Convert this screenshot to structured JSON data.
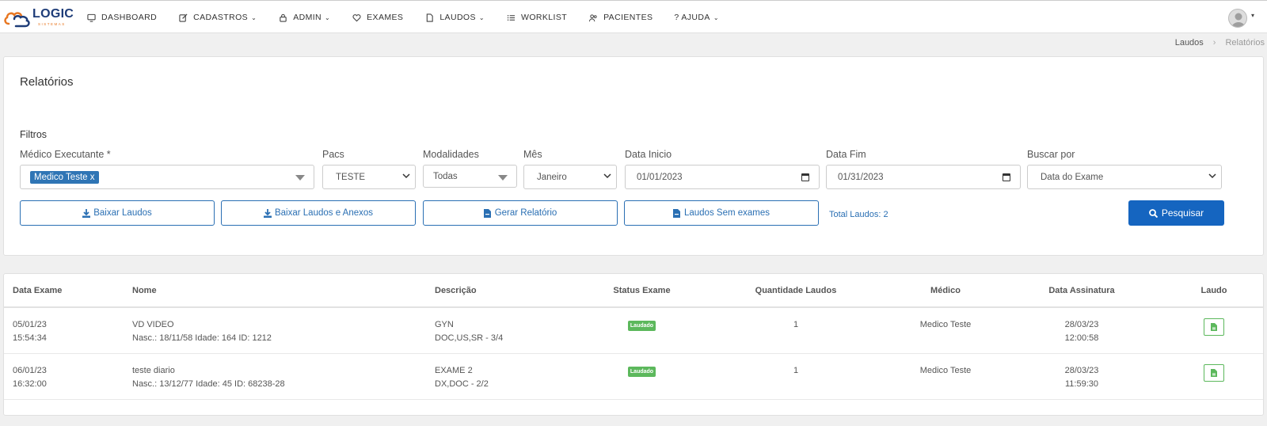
{
  "brand": {
    "name": "LOGIC",
    "sub": "SISTEMAS"
  },
  "nav": [
    {
      "label": "DASHBOARD",
      "icon": "monitor-icon",
      "caret": false
    },
    {
      "label": "CADASTROS",
      "icon": "edit-icon",
      "caret": true
    },
    {
      "label": "ADMIN",
      "icon": "lock-icon",
      "caret": true
    },
    {
      "label": "EXAMES",
      "icon": "heart-icon",
      "caret": false
    },
    {
      "label": "LAUDOS",
      "icon": "file-icon",
      "caret": true
    },
    {
      "label": "WORKLIST",
      "icon": "list-icon",
      "caret": false
    },
    {
      "label": "PACIENTES",
      "icon": "users-icon",
      "caret": false
    },
    {
      "label": "? AJUDA",
      "icon": "",
      "caret": true
    }
  ],
  "breadcrumb": {
    "parent": "Laudos",
    "current": "Relatórios"
  },
  "page_title": "Relatórios",
  "filters": {
    "title": "Filtros",
    "medico": {
      "label": "Médico Executante *",
      "tag": "Medico Teste",
      "tag_remove": "x"
    },
    "pacs": {
      "label": "Pacs",
      "value": "TESTE"
    },
    "modalidades": {
      "label": "Modalidades",
      "value": "Todas"
    },
    "mes": {
      "label": "Mês",
      "value": "Janeiro"
    },
    "data_inicio": {
      "label": "Data Inicio",
      "value": "01/01/2023"
    },
    "data_fim": {
      "label": "Data Fim",
      "value": "01/31/2023"
    },
    "buscar_por": {
      "label": "Buscar por",
      "value": "Data do Exame"
    }
  },
  "actions": {
    "baixar_laudos": "Baixar Laudos",
    "baixar_anexos": "Baixar Laudos e Anexos",
    "gerar_relatorio": "Gerar Relatório",
    "sem_exames": "Laudos Sem exames",
    "total": "Total Laudos: 2",
    "pesquisar": "Pesquisar"
  },
  "table": {
    "headers": [
      "Data Exame",
      "Nome",
      "Descrição",
      "Status Exame",
      "Quantidade Laudos",
      "Médico",
      "Data Assinatura",
      "Laudo"
    ],
    "rows": [
      {
        "date": "05/01/23",
        "time": "15:54:34",
        "name": "VD VIDEO",
        "info": "Nasc.: 18/11/58 Idade: 164 ID: 1212",
        "desc1": "GYN",
        "desc2": "DOC,US,SR - 3/4",
        "status": "Laudado",
        "qty": "1",
        "medico": "Medico Teste",
        "sign_date": "28/03/23",
        "sign_time": "12:00:58"
      },
      {
        "date": "06/01/23",
        "time": "16:32:00",
        "name": "teste diario",
        "info": "Nasc.: 13/12/77 Idade: 45 ID: 68238-28",
        "desc1": "EXAME 2",
        "desc2": "DX,DOC - 2/2",
        "status": "Laudado",
        "qty": "1",
        "medico": "Medico Teste",
        "sign_date": "28/03/23",
        "sign_time": "11:59:30"
      }
    ]
  },
  "colors": {
    "primary": "#1565c0",
    "outline": "#2a6fb3",
    "success": "#5cb85c",
    "brand_blue": "#1e3c78",
    "brand_orange": "#e87722"
  }
}
